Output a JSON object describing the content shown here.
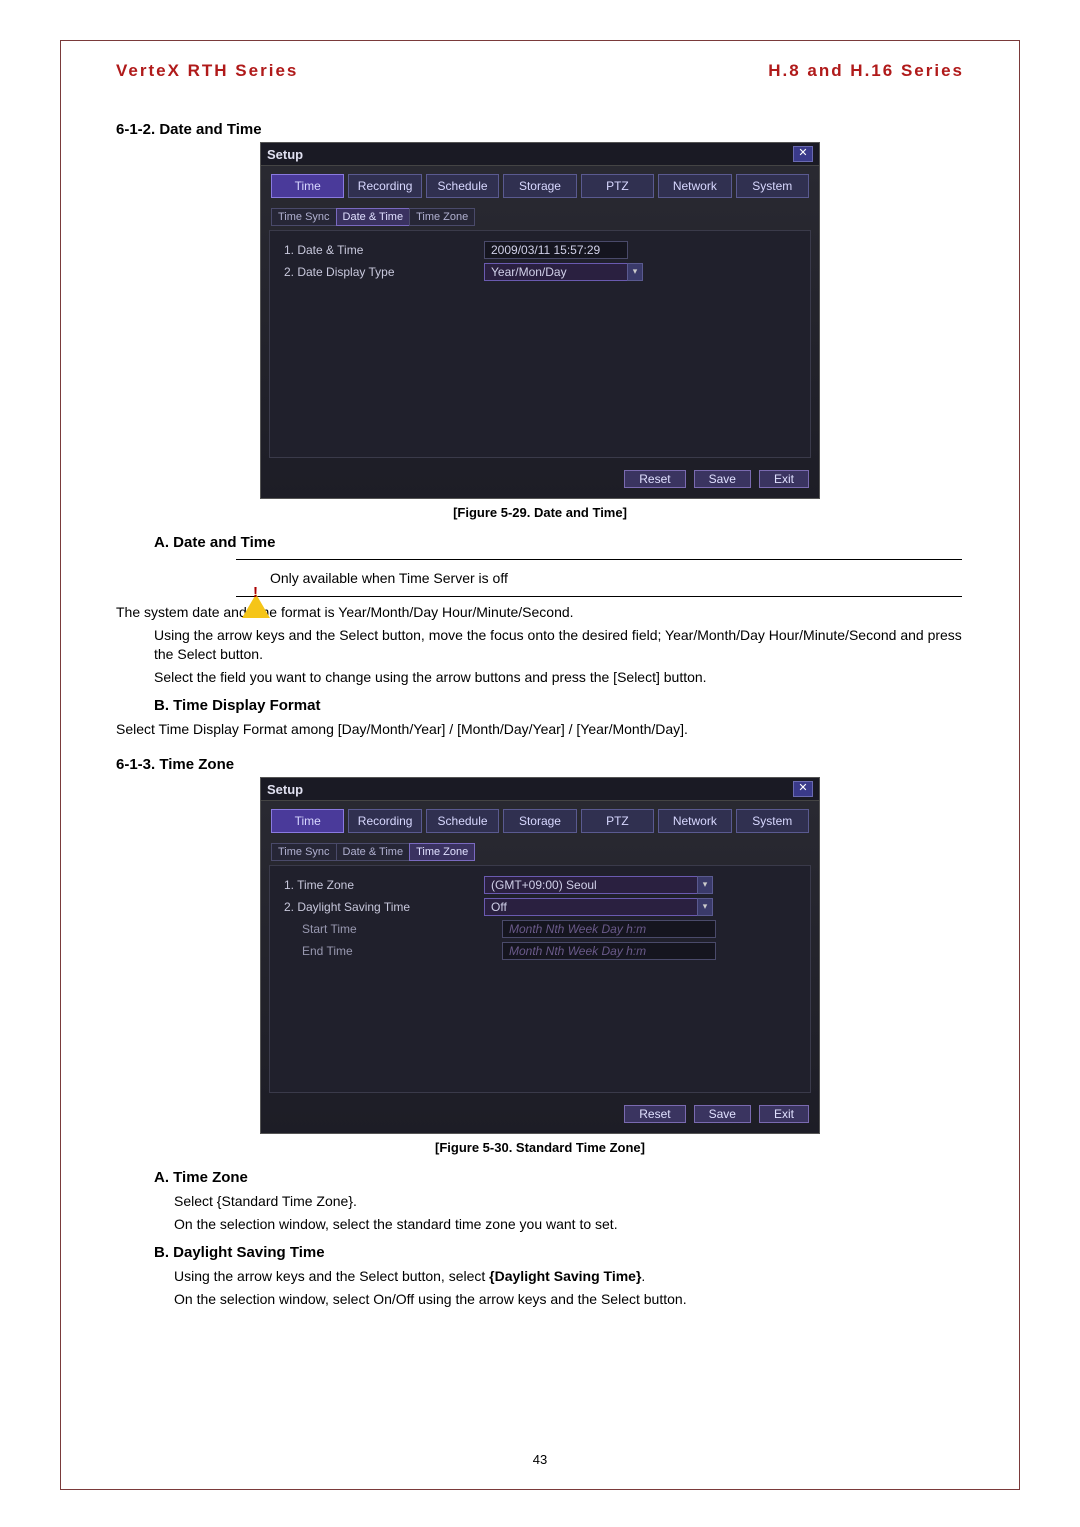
{
  "header": {
    "left": "VerteX RTH Series",
    "right": "H.8 and H.16 Series"
  },
  "section612": {
    "heading": "6-1-2.  Date and Time"
  },
  "screenshot1": {
    "title": "Setup",
    "close": "✕",
    "tabs": [
      "Time",
      "Recording",
      "Schedule",
      "Storage",
      "PTZ",
      "Network",
      "System"
    ],
    "activeTab": 0,
    "subtabs": [
      "Time Sync",
      "Date & Time",
      "Time Zone"
    ],
    "activeSubtab": 1,
    "rows": {
      "r1label": "1. Date & Time",
      "r1value": "2009/03/11  15:57:29",
      "r2label": "2. Date Display Type",
      "r2value": "Year/Mon/Day"
    },
    "buttons": {
      "reset": "Reset",
      "save": "Save",
      "exit": "Exit"
    }
  },
  "caption1": "[Figure 5-29. Date and Time]",
  "subA": "A.    Date and Time",
  "warn1": "Only available when Time Server is off",
  "para1a": "The system date and time format is Year/Month/Day Hour/Minute/Second.",
  "para1b": "Using the arrow keys and the Select button, move the focus onto the desired field; Year/Month/Day Hour/Minute/Second and press the Select button.",
  "para1c": "Select the field you want to change using the arrow buttons and press the [Select] button.",
  "subB": "B.    Time Display Format",
  "para2": "Select Time Display Format among [Day/Month/Year] / [Month/Day/Year] / [Year/Month/Day].",
  "section613": {
    "heading": "6-1-3.  Time Zone"
  },
  "screenshot2": {
    "title": "Setup",
    "close": "✕",
    "tabs": [
      "Time",
      "Recording",
      "Schedule",
      "Storage",
      "PTZ",
      "Network",
      "System"
    ],
    "activeTab": 0,
    "subtabs": [
      "Time Sync",
      "Date & Time",
      "Time Zone"
    ],
    "activeSubtab": 2,
    "rows": {
      "r1label": "1. Time Zone",
      "r1value": "(GMT+09:00) Seoul",
      "r2label": "2. Daylight Saving Time",
      "r2value": "Off",
      "r3label": "Start Time",
      "r3value": "Month Nth Week Day h:m",
      "r4label": "End Time",
      "r4value": "Month Nth Week Day h:m"
    },
    "buttons": {
      "reset": "Reset",
      "save": "Save",
      "exit": "Exit"
    }
  },
  "caption2": "[Figure 5-30. Standard Time Zone]",
  "subA2": "A.     Time Zone",
  "para3a": "Select {Standard Time Zone}.",
  "para3b": "On the selection window, select the standard time zone you want to set.",
  "subB2": "B.    Daylight Saving Time",
  "para4a_pre": "Using the arrow keys and the Select button, select ",
  "para4a_bold": "{Daylight Saving Time}",
  "para4a_post": ".",
  "para4b": "On the selection window, select On/Off using the arrow keys and the Select button.",
  "pageNumber": "43"
}
